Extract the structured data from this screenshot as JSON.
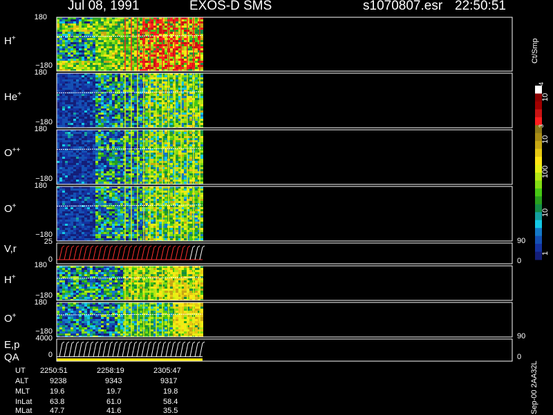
{
  "header": {
    "date": "Jul 08, 1991",
    "instrument": "EXOS-D SMS",
    "file": "s1070807.esr",
    "time": "22:50:51"
  },
  "colors": {
    "background": "#000000",
    "axes": "#ffffff",
    "vector_red": "#ff3030",
    "vector_white": "#ffffff",
    "qa_bar": "#ffe600"
  },
  "panels": [
    {
      "id": "h-plus",
      "label": "H",
      "sup": "+",
      "ymax": "180",
      "ymin": "−180"
    },
    {
      "id": "he-plus",
      "label": "He",
      "sup": "+",
      "ymax": "180",
      "ymin": "−180"
    },
    {
      "id": "o-plusplus",
      "label": "O",
      "sup": "++",
      "ymax": "180",
      "ymin": "−180"
    },
    {
      "id": "o-plus",
      "label": "O",
      "sup": "+",
      "ymax": "180",
      "ymin": "−180"
    },
    {
      "id": "vr",
      "label": "V,r",
      "sup": "",
      "ymax": "25",
      "ymin": "0",
      "rmax": "90",
      "rmin": "0"
    },
    {
      "id": "h-plus-2",
      "label": "H",
      "sup": "+",
      "ymax": "180",
      "ymin": "−180"
    },
    {
      "id": "o-plus-2",
      "label": "O",
      "sup": "+",
      "ymax": "180",
      "ymin": "−180"
    },
    {
      "id": "ep-qa",
      "label": "E,p",
      "sup": "",
      "label2": "QA",
      "ymax": "4000",
      "ymin": "0",
      "rmax": "90",
      "rmin": "0"
    }
  ],
  "colorbar": {
    "unit": "Ct/Smp",
    "labels": [
      "10",
      "4",
      "10",
      "3",
      "100",
      "10",
      "1"
    ],
    "colors": [
      "#ffffff",
      "#8b0000",
      "#a00000",
      "#c81414",
      "#ff1e1e",
      "#8c7a1a",
      "#a88c14",
      "#c8a814",
      "#e6c814",
      "#ffe614",
      "#e6f014",
      "#b4e614",
      "#82dc14",
      "#46c814",
      "#28a01e",
      "#148c46",
      "#14a0a0",
      "#14c8e6",
      "#1478c8",
      "#1450b4",
      "#1432a0",
      "#141e78"
    ]
  },
  "footer": {
    "rows": [
      {
        "name": "UT",
        "values": [
          "2250:51",
          "2258:19",
          "2305:47"
        ]
      },
      {
        "name": "ALT",
        "values": [
          "9238",
          "9343",
          "9317"
        ]
      },
      {
        "name": "MLT",
        "values": [
          "19.6",
          "19.7",
          "19.8"
        ]
      },
      {
        "name": "InLat",
        "values": [
          "63.8",
          "61.0",
          "58.4"
        ]
      },
      {
        "name": "MLat",
        "values": [
          "47.7",
          "41.6",
          "35.5"
        ]
      }
    ],
    "side_text": "Sep-00 2AA32L"
  },
  "chart_data": {
    "type": "heatmap",
    "title": "Jul 08, 1991 EXOS-D SMS",
    "x_axis": "UT",
    "x_ticks": [
      "2250:51",
      "2258:19",
      "2305:47"
    ],
    "y_range_pitch": [
      -180,
      180
    ],
    "colorbar_unit": "Ct/Smp",
    "colorbar_range": [
      1,
      10000
    ],
    "colorbar_scale": "log",
    "panels": [
      "H+",
      "He+",
      "O++",
      "O+",
      "V,r",
      "H+",
      "O+",
      "E,p / QA"
    ],
    "data_coverage": "first ~27% of time span"
  }
}
